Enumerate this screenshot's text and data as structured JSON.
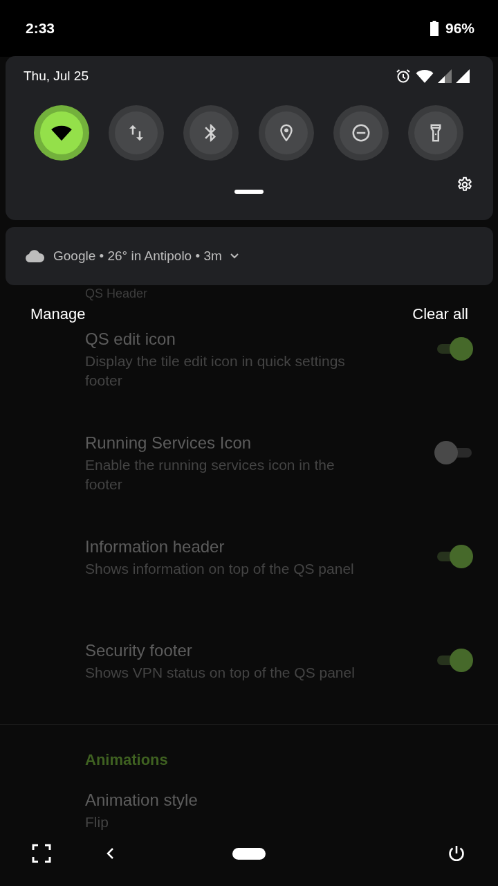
{
  "status_bar": {
    "time": "2:33",
    "battery": "96%"
  },
  "quick_settings": {
    "date": "Thu, Jul 25",
    "tiles": [
      {
        "kind": "wifi",
        "on": true
      },
      {
        "kind": "data",
        "on": false
      },
      {
        "kind": "bluetooth",
        "on": false
      },
      {
        "kind": "location",
        "on": false
      },
      {
        "kind": "dnd",
        "on": false
      },
      {
        "kind": "flashlight",
        "on": false
      }
    ]
  },
  "notification": {
    "text": "Google • 26° in Antipolo • 3m"
  },
  "notification_actions": {
    "manage": "Manage",
    "clear_all": "Clear all"
  },
  "settings": {
    "partial_title": "QS Header",
    "items": [
      {
        "kind": "switch",
        "title": "QS edit icon",
        "summary": "Display the tile edit icon in quick settings footer",
        "on": true
      },
      {
        "kind": "switch",
        "title": "Running Services Icon",
        "summary": "Enable the running services icon in the footer",
        "on": false
      },
      {
        "kind": "switch",
        "title": "Information header",
        "summary": "Shows information on top of the QS panel",
        "on": true
      },
      {
        "kind": "switch",
        "title": "Security footer",
        "summary": "Shows VPN status on top of the QS panel",
        "on": true
      },
      {
        "kind": "divider"
      },
      {
        "kind": "header",
        "title": "Animations"
      },
      {
        "kind": "value",
        "title": "Animation style",
        "summary": "Flip"
      }
    ]
  }
}
